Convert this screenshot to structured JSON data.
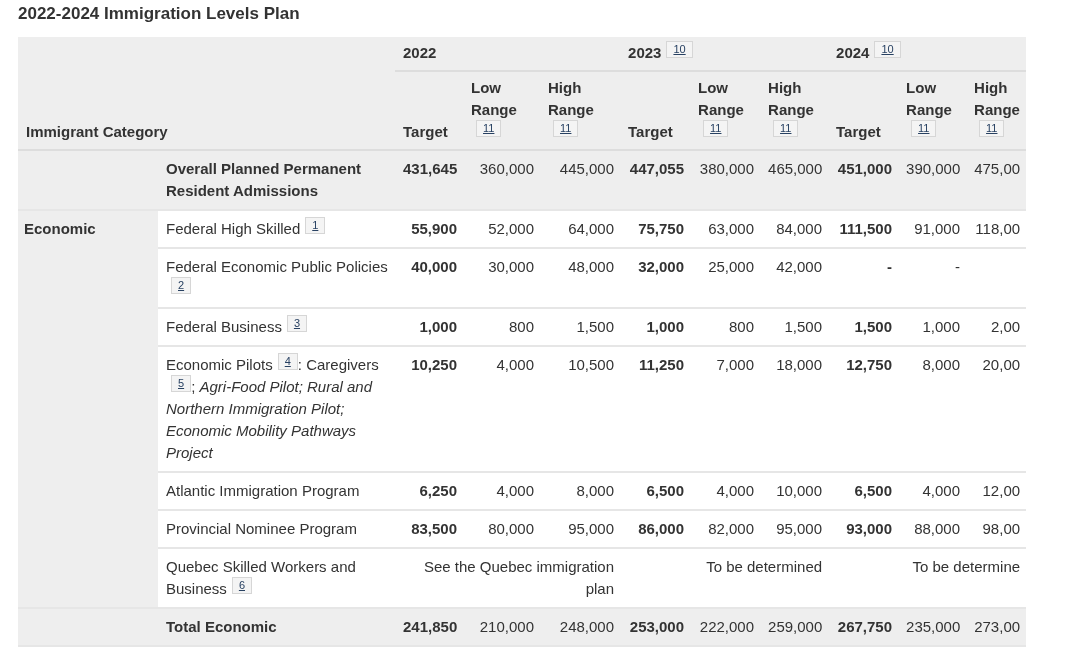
{
  "title": "2022-2024 Immigration Levels Plan",
  "table": {
    "category_heading": "Immigrant Category",
    "years": [
      {
        "year": "2022",
        "columns": [
          {
            "label": "Target"
          },
          {
            "label": "Low Range",
            "note": "11"
          },
          {
            "label": "High Range",
            "note": "11"
          }
        ]
      },
      {
        "year": "2023",
        "note": "10",
        "columns": [
          {
            "label": "Target"
          },
          {
            "label": "Low Range",
            "note": "11"
          },
          {
            "label": "High Range",
            "note": "11"
          }
        ]
      },
      {
        "year": "2024",
        "note": "10",
        "columns": [
          {
            "label": "Target"
          },
          {
            "label": "Low Range",
            "note": "11"
          },
          {
            "label": "High Range",
            "note": "11"
          }
        ]
      }
    ],
    "summary_row": {
      "label": "Overall Planned Permanent Resident Admissions",
      "values": [
        "431,645",
        "360,000",
        "445,000",
        "447,055",
        "380,000",
        "465,000",
        "451,000",
        "390,000",
        "475,00"
      ]
    },
    "groups": [
      {
        "category": "Economic",
        "rows": [
          {
            "kind": "values",
            "label": [
              {
                "text": "Federal High Skilled"
              },
              {
                "note": "1"
              }
            ],
            "values": [
              "55,900",
              "52,000",
              "64,000",
              "75,750",
              "63,000",
              "84,000",
              "111,500",
              "91,000",
              "118,00"
            ]
          },
          {
            "kind": "values",
            "label": [
              {
                "text": "Federal Economic Public Policies"
              },
              {
                "note": "2"
              }
            ],
            "values": [
              "40,000",
              "30,000",
              "48,000",
              "32,000",
              "25,000",
              "42,000",
              "-",
              "-"
            ]
          },
          {
            "kind": "values",
            "label": [
              {
                "text": "Federal Business"
              },
              {
                "note": "3"
              }
            ],
            "values": [
              "1,000",
              "800",
              "1,500",
              "1,000",
              "800",
              "1,500",
              "1,500",
              "1,000",
              "2,00"
            ]
          },
          {
            "kind": "values",
            "label": [
              {
                "text": "Economic Pilots"
              },
              {
                "note": "4"
              },
              {
                "text": ": Caregivers"
              },
              {
                "note": "5"
              },
              {
                "text": "; *Agri-Food Pilot; Rural and Northern Immigration Pilot; Economic Mobility Pathways Project*"
              }
            ],
            "values": [
              "10,250",
              "4,000",
              "10,500",
              "11,250",
              "7,000",
              "18,000",
              "12,750",
              "8,000",
              "20,00"
            ]
          },
          {
            "kind": "values",
            "label": [
              {
                "text": "Atlantic Immigration Program"
              }
            ],
            "values": [
              "6,250",
              "4,000",
              "8,000",
              "6,500",
              "4,000",
              "10,000",
              "6,500",
              "4,000",
              "12,00"
            ]
          },
          {
            "kind": "values",
            "label": [
              {
                "text": "Provincial Nominee Program"
              }
            ],
            "values": [
              "83,500",
              "80,000",
              "95,000",
              "86,000",
              "82,000",
              "95,000",
              "93,000",
              "88,000",
              "98,00"
            ]
          },
          {
            "kind": "spanned",
            "label": [
              {
                "text": "Quebec Skilled Workers and Business"
              },
              {
                "note": "6"
              }
            ],
            "values": [
              "See the Quebec immigration plan",
              "To be determined",
              "To be determine"
            ]
          }
        ],
        "total": {
          "label": "Total Economic",
          "values": [
            "241,850",
            "210,000",
            "248,000",
            "253,000",
            "222,000",
            "259,000",
            "267,750",
            "235,000",
            "273,00"
          ]
        }
      }
    ]
  }
}
